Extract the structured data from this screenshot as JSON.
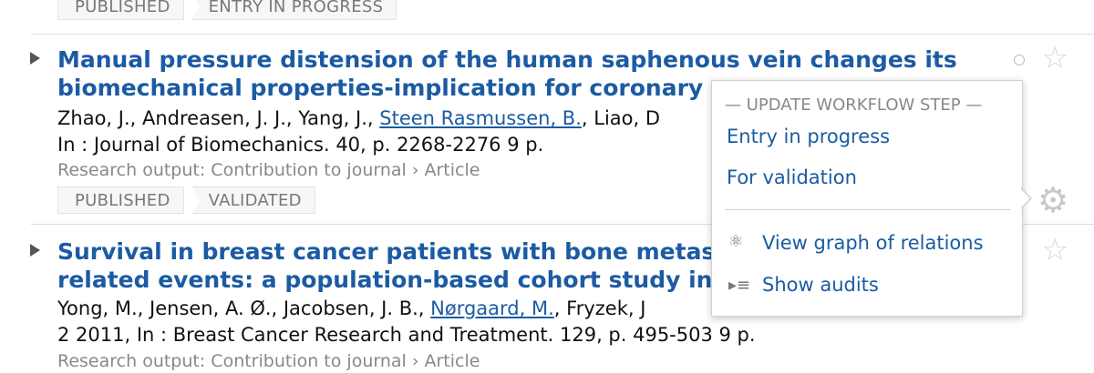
{
  "top_tags": [
    "PUBLISHED",
    "ENTRY IN PROGRESS"
  ],
  "entries": [
    {
      "title_line1": "Manual pressure distension of the human saphenous vein changes its",
      "title_line2": "biomechanical properties-implication for coronary ar",
      "authors_pre": "Zhao, J., Andreasen, J. J., Yang, J., ",
      "authors_link": "Steen Rasmussen, B.",
      "authors_post": ", Liao, D",
      "journal": "In : Journal of Biomechanics. 40, p. 2268-2276 9 p.",
      "type": "Research output: Contribution to journal › Article",
      "tags": [
        "PUBLISHED",
        "VALIDATED"
      ]
    },
    {
      "title_line1": "Survival in breast cancer patients with bone metastas",
      "title_line2": "related events: a population-based cohort study in De",
      "authors_pre": "Yong, M., Jensen, A. Ø., Jacobsen, J. B., ",
      "authors_link": "Nørgaard, M.",
      "authors_post": ", Fryzek, J",
      "journal": "2 2011, In : Breast Cancer Research and Treatment. 129, p. 495-503 9 p.",
      "type": "Research output: Contribution to journal › Article"
    }
  ],
  "popup": {
    "heading": "— UPDATE WORKFLOW STEP —",
    "steps": [
      "Entry in progress",
      "For validation"
    ],
    "actions": [
      "View graph of relations",
      "Show audits"
    ]
  },
  "icons": {
    "expand": "triangle-right-icon",
    "status": "circle-icon",
    "favorite": "star-icon",
    "settings": "gear-icon",
    "graph": "atom-icon",
    "audits": "list-icon"
  },
  "colors": {
    "link": "#1b5ba3",
    "muted": "#888888"
  }
}
